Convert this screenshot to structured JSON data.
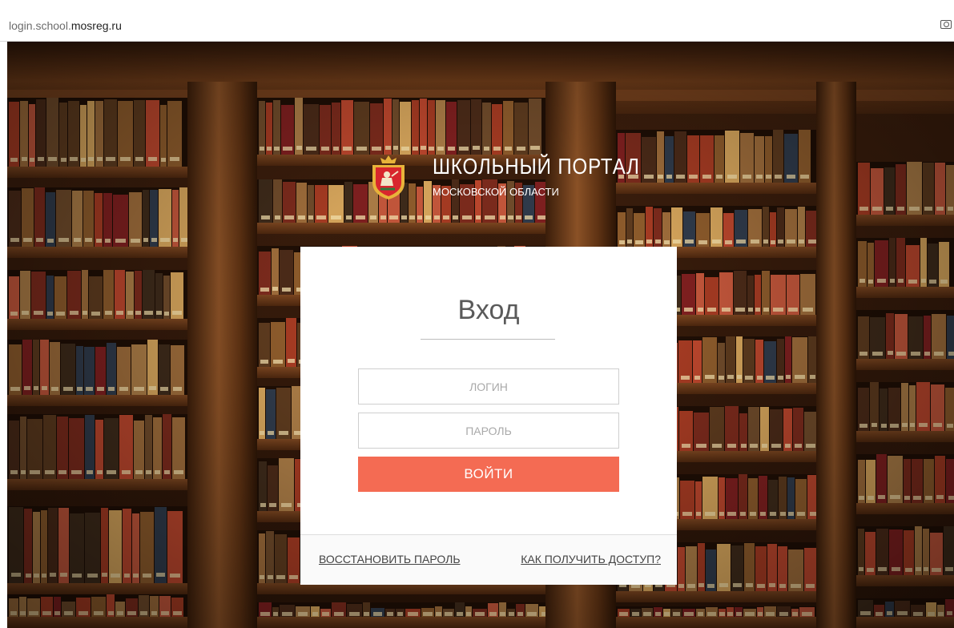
{
  "browser": {
    "url_sub": "login.school.",
    "url_domain": "mosreg.ru",
    "camera_icon": "camera-icon"
  },
  "header": {
    "title": "ШКОЛЬНЫЙ ПОРТАЛ",
    "subtitle": "МОСКОВСКОЙ ОБЛАСТИ",
    "emblem_icon": "moscow-oblast-coat-of-arms"
  },
  "login_form": {
    "heading": "Вход",
    "login_placeholder": "ЛОГИН",
    "login_value": "",
    "password_placeholder": "ПАРОЛЬ",
    "password_value": "",
    "submit_label": "ВОЙТИ"
  },
  "footer_links": {
    "restore_password": "ВОССТАНОВИТЬ ПАРОЛЬ",
    "how_to_get_access": "КАК ПОЛУЧИТЬ ДОСТУП?"
  },
  "colors": {
    "accent": "#f46b53",
    "card_bg": "#ffffff"
  }
}
